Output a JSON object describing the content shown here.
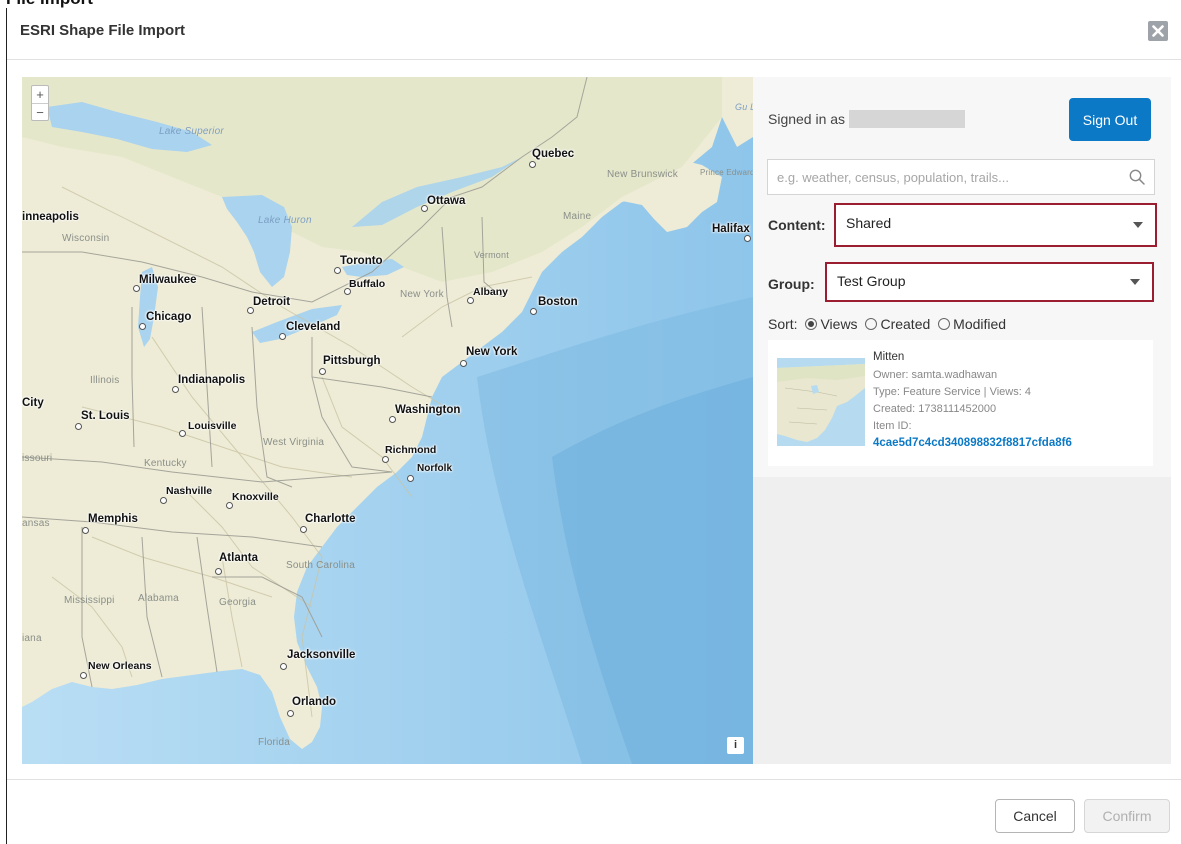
{
  "window": {
    "top_strip_text": "File Import",
    "dialog_title": "ESRI Shape File Import"
  },
  "map": {
    "zoom_in": "+",
    "zoom_out": "−",
    "attribution": "i",
    "cities": [
      "Quebec",
      "Ottawa",
      "Halifax",
      "Toronto",
      "Buffalo",
      "Albany",
      "Boston",
      "Milwaukee",
      "Detroit",
      "Chicago",
      "Cleveland",
      "Pittsburgh",
      "New York",
      "Indianapolis",
      "St. Louis",
      "Louisville",
      "Washington",
      "Richmond",
      "Norfolk",
      "Nashville",
      "Knoxville",
      "Memphis",
      "Charlotte",
      "Atlanta",
      "Jacksonville",
      "New Orleans",
      "Orlando",
      "City",
      "inneapolis"
    ],
    "regions": [
      "Lake Superior",
      "Lake Huron",
      "New Brunswick",
      "Prince Edward Island",
      "Maine",
      "Vermont",
      "New York",
      "Wisconsin",
      "Illinois",
      "West Virginia",
      "Kentucky",
      "issouri",
      "ansas",
      "South Carolina",
      "Georgia",
      "Alabama",
      "Mississippi",
      "iana",
      "Florida",
      "Gu La"
    ]
  },
  "panel": {
    "signed_in_label": "Signed in as",
    "sign_out": "Sign Out",
    "search_placeholder": "e.g. weather, census, population, trails...",
    "content_label": "Content:",
    "content_value": "Shared",
    "group_label": "Group:",
    "group_value": "Test Group",
    "sort_label": "Sort:",
    "sort_options": [
      "Views",
      "Created",
      "Modified"
    ],
    "sort_selected": "Views",
    "result": {
      "title": "Mitten",
      "owner": "Owner: samta.wadhawan",
      "type": "Type: Feature Service | Views: 4",
      "created": "Created: 1738111452000",
      "item_id_label": "Item ID:",
      "item_id": "4cae5d7c4cd340898832f8817cfda8f6"
    }
  },
  "footer": {
    "cancel": "Cancel",
    "confirm": "Confirm"
  },
  "colors": {
    "primary": "#0b79c6",
    "highlight_border": "#9a1e2f",
    "land": "#eeecd6",
    "water": "#a9d3ee"
  }
}
